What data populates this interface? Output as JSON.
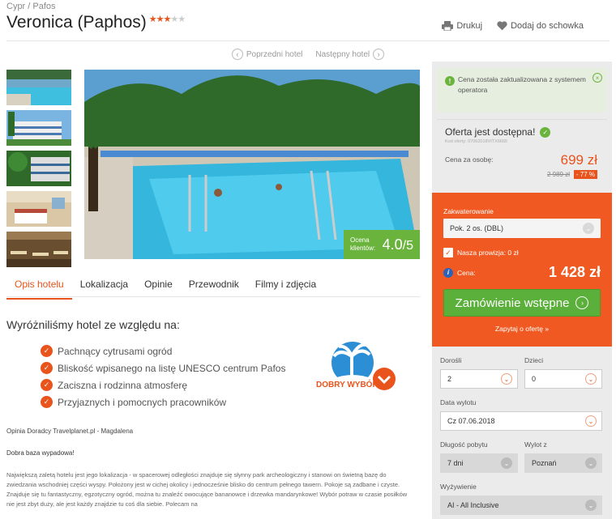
{
  "breadcrumb": "Cypr / Pafos",
  "hotel": {
    "name": "Veronica (Paphos)",
    "stars_filled": 3,
    "stars_total": 5
  },
  "actions": {
    "print": "Drukuj",
    "save": "Dodaj do schowka"
  },
  "nav": {
    "prev": "Poprzedni hotel",
    "next": "Następny hotel"
  },
  "rating": {
    "label": "Ocena klientów:",
    "value": "4.0",
    "max": "/5"
  },
  "tabs": [
    "Opis hotelu",
    "Lokalizacja",
    "Opinie",
    "Przewodnik",
    "Filmy i zdjęcia"
  ],
  "why": {
    "title": "Wyróżniliśmy hotel ze względu na:",
    "items": [
      "Pachnący cytrusami ogród",
      "Bliskość wpisanego na listę UNESCO centrum Pafos",
      "Zaciszna i rodzinna atmosferę",
      "Przyjaznych i pomocnych pracowników"
    ],
    "badge": "DOBRY WYBÓR"
  },
  "advisor": "Opinia Doradcy Travelplanet.pl - Magdalena",
  "review_title": "Dobra baza wypadowa!",
  "review_text": "Największą zaletą hotelu jest jego lokalizacja - w spacerowej odległości znajduje się słynny park archeologiczny i stanowi on świetną bazę do zwiedzania wschodniej części wyspy. Położony jest w cichej okolicy i jednocześnie blisko do centrum pełnego tawern. Pokoje są zadbane i czyste. Znajduje się tu fantastyczny, egzotyczny ogród, można tu znaleźć owocujące bananowce i drzewka mandarynkowe! Wybór potraw w czasie posiłków nie jest zbyt duży, ale jest każdy znajdzie tu coś dla siebie. Polecam na",
  "sidebar": {
    "notice": "Cena została zaktualizowana z systemem operatora",
    "offer_title": "Oferta jest dostępna!",
    "offer_code": "Kod oferty: 07062018VITX6665",
    "price_label": "Cena za osobę:",
    "price": "699 zł",
    "old_price": "2 989 zł",
    "discount": "- 77 %",
    "accommodation_label": "Zakwaterowanie",
    "accommodation_value": "Pok. 2 os. (DBL)",
    "commission": "Nasza prowizja: 0 zł",
    "total_label": "Cena:",
    "total": "1 428 zł",
    "order_button": "Zamówienie wstępne",
    "ask_link": "Zapytaj o ofertę »",
    "adults_label": "Dorośli",
    "adults_value": "2",
    "children_label": "Dzieci",
    "children_value": "0",
    "departure_label": "Data wylotu",
    "departure_value": "Cz 07.06.2018",
    "duration_label": "Długość pobytu",
    "duration_value": "7 dni",
    "from_label": "Wylot z",
    "from_value": "Poznań",
    "board_label": "Wyżywienie",
    "board_value": "AI - All Inclusive"
  },
  "colors": {
    "accent": "#e8541c",
    "green": "#5ab03a",
    "sidebar_orange": "#f05a22"
  }
}
